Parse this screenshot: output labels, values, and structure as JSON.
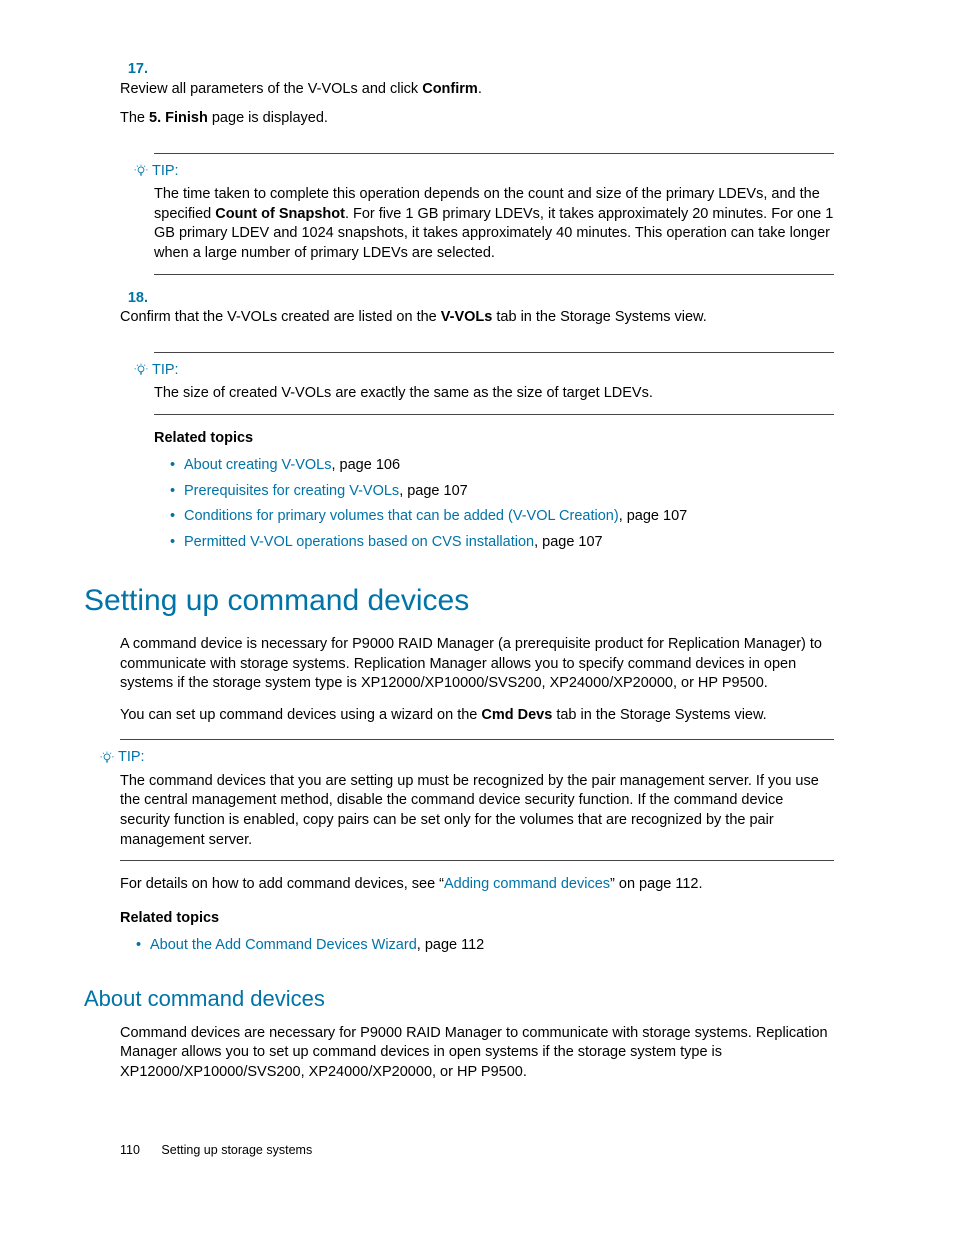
{
  "steps": {
    "s17": {
      "num": "17.",
      "text_pre": "Review all parameters of the V-VOLs and click ",
      "bold1": "Confirm",
      "text_post": ".",
      "line2_pre": "The ",
      "line2_bold": "5. Finish",
      "line2_post": " page is displayed."
    },
    "s18": {
      "num": "18.",
      "text_pre": "Confirm that the V-VOLs created are listed on the ",
      "bold1": "V-VOLs",
      "text_post": " tab in the Storage Systems view."
    }
  },
  "tips": {
    "label": "TIP:",
    "t1_pre": "The time taken to complete this operation depends on the count and size of the primary LDEVs, and the specified ",
    "t1_bold": "Count of Snapshot",
    "t1_post": ". For five 1 GB primary LDEVs, it takes approximately 20 minutes. For one 1 GB primary LDEV and 1024 snapshots, it takes approximately 40 minutes. This operation can take longer when a large number of primary LDEVs are selected.",
    "t2": "The size of created V-VOLs are exactly the same as the size of target LDEVs.",
    "t3": "The command devices that you are setting up must be recognized by the pair management server. If you use the central management method, disable the command device security function. If the command device security function is enabled, copy pairs can be set only for the volumes that are recognized by the pair management server."
  },
  "related": {
    "heading": "Related topics",
    "r1": {
      "link": "About creating V-VOLs",
      "tail": ", page 106"
    },
    "r2": {
      "link": "Prerequisites for creating V-VOLs",
      "tail": ", page 107"
    },
    "r3": {
      "link": "Conditions for primary volumes that can be added (V-VOL Creation)",
      "tail": ", page 107"
    },
    "r4": {
      "link": "Permitted V-VOL operations based on CVS installation",
      "tail": ", page 107"
    },
    "r5": {
      "link": "About the Add Command Devices Wizard",
      "tail": ", page 112"
    }
  },
  "section": {
    "h1": "Setting up command devices",
    "p1": "A command device is necessary for P9000 RAID Manager (a prerequisite product for Replication Manager) to communicate with storage systems. Replication Manager allows you to specify command devices in open systems if the storage system type is XP12000/XP10000/SVS200, XP24000/XP20000, or HP P9500.",
    "p2_pre": "You can set up command devices using a wizard on the ",
    "p2_bold": "Cmd Devs",
    "p2_post": " tab in the Storage Systems view.",
    "p3_pre": "For details on how to add command devices, see “",
    "p3_link": "Adding command devices",
    "p3_post": "” on page 112.",
    "h2": "About command devices",
    "p4": "Command devices are necessary for P9000 RAID Manager to communicate with storage systems. Replication Manager allows you to set up command devices in open systems if the storage system type is XP12000/XP10000/SVS200, XP24000/XP20000, or HP P9500."
  },
  "footer": {
    "page": "110",
    "title": "Setting up storage systems"
  }
}
